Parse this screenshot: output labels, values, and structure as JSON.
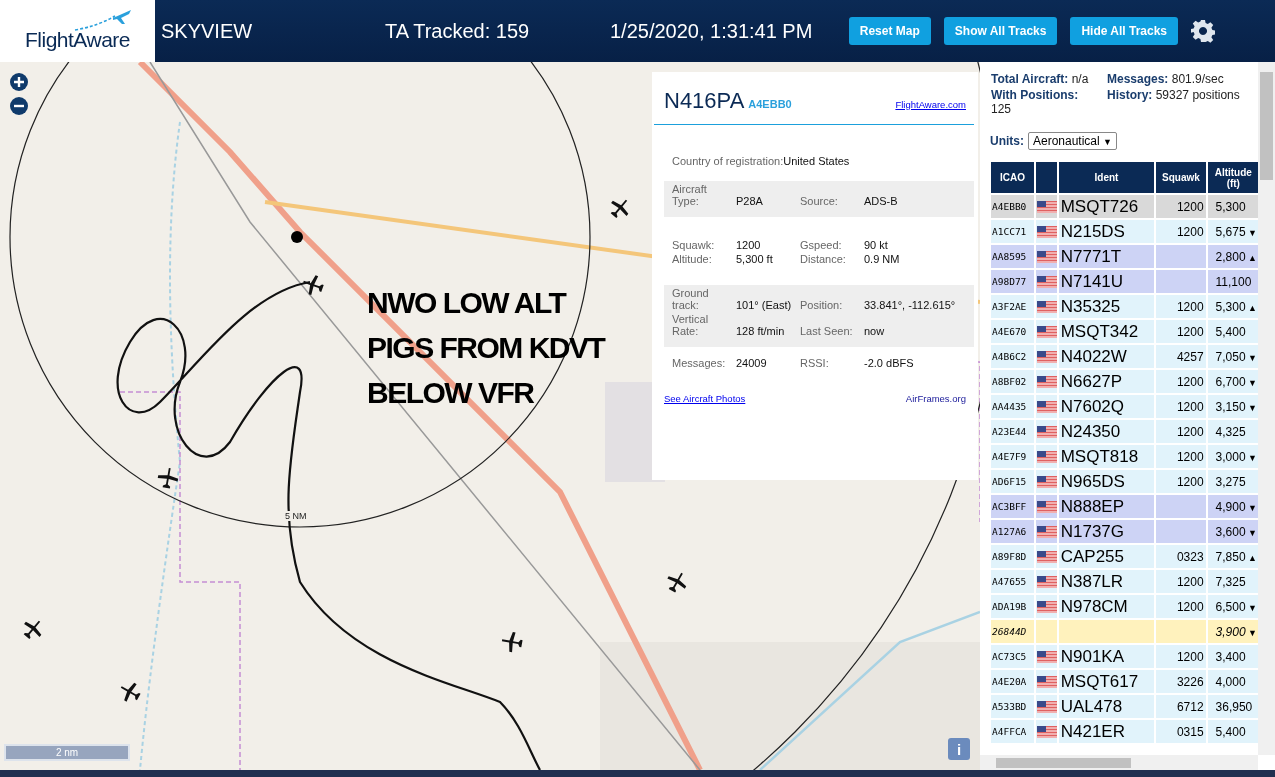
{
  "header": {
    "logo_text": "FlightAware",
    "app_title": "SKYVIEW",
    "tracked": "TA Tracked: 159",
    "datetime": "1/25/2020, 1:31:41 PM",
    "buttons": [
      "Reset Map",
      "Show All Tracks",
      "Hide All Tracks"
    ]
  },
  "map": {
    "annotation": [
      "NWO LOW ALT",
      "PIGS FROM KDVT",
      "BELOW VFR"
    ],
    "range_label": "5 NM",
    "scale": "2 nm",
    "info": "i"
  },
  "popup": {
    "ident": "N416PA",
    "icao": "A4EBB0",
    "link": "FlightAware.com",
    "country_label": "Country of registration:",
    "country": "United States",
    "groups": [
      {
        "shaded": true,
        "rows": [
          [
            "Aircraft Type:",
            "P28A",
            "Source:",
            "ADS-B"
          ]
        ]
      },
      {
        "shaded": false,
        "rows": [
          [
            "Squawk:",
            "1200",
            "Gspeed:",
            "90 kt"
          ],
          [
            "Altitude:",
            "5,300 ft",
            "Distance:",
            "0.9 NM"
          ]
        ]
      },
      {
        "shaded": true,
        "rows": [
          [
            "Ground track:",
            "101° (East)",
            "Position:",
            "33.841°, -112.615°"
          ],
          [
            "Vertical Rate:",
            "128 ft/min",
            "Last Seen:",
            "now"
          ]
        ]
      },
      {
        "shaded": false,
        "rows": [
          [
            "Messages:",
            "24009",
            "RSSI:",
            "-2.0 dBFS"
          ]
        ]
      }
    ],
    "photos_link": "See Aircraft Photos",
    "airframes_link": "AirFrames.org"
  },
  "stats": [
    {
      "label": "Total Aircraft:",
      "value": "n/a"
    },
    {
      "label": "Messages:",
      "value": "801.9/sec"
    },
    {
      "label": "With Positions:",
      "value": "125"
    },
    {
      "label": "History:",
      "value": "59327 positions"
    }
  ],
  "units": {
    "label": "Units:",
    "value": "Aeronautical",
    "caret": "▼"
  },
  "table": {
    "columns": [
      "ICAO",
      "",
      "Ident",
      "Squawk",
      "Altitude (ft)"
    ],
    "rows": [
      {
        "icao": "A4EBB0",
        "flag": true,
        "ident": "MSQT726",
        "squawk": "1200",
        "altitude": "5,300",
        "trend": "",
        "selected": true,
        "kind": "adsb"
      },
      {
        "icao": "A1CC71",
        "flag": true,
        "ident": "N215DS",
        "squawk": "1200",
        "altitude": "5,675",
        "trend": "▼",
        "selected": false,
        "kind": "adsb",
        "color": "#e1f3fb"
      },
      {
        "icao": "AA8595",
        "flag": true,
        "ident": "N7771T",
        "squawk": "",
        "altitude": "2,800",
        "trend": "▲",
        "selected": false,
        "kind": "adsb",
        "color": "#cdd3f5"
      },
      {
        "icao": "A98D77",
        "flag": true,
        "ident": "N7141U",
        "squawk": "",
        "altitude": "11,100",
        "trend": "",
        "selected": false,
        "kind": "adsb",
        "color": "#cdd3f5"
      },
      {
        "icao": "A3F2AE",
        "flag": true,
        "ident": "N35325",
        "squawk": "1200",
        "altitude": "5,300",
        "trend": "▲",
        "selected": false,
        "kind": "adsb",
        "color": "#e1f3fb"
      },
      {
        "icao": "A4E670",
        "flag": true,
        "ident": "MSQT342",
        "squawk": "1200",
        "altitude": "5,400",
        "trend": "",
        "selected": false,
        "kind": "adsb",
        "color": "#e1f3fb"
      },
      {
        "icao": "A4B6C2",
        "flag": true,
        "ident": "N4022W",
        "squawk": "4257",
        "altitude": "7,050",
        "trend": "▼",
        "selected": false,
        "kind": "adsb",
        "color": "#e1f3fb"
      },
      {
        "icao": "A8BF02",
        "flag": true,
        "ident": "N6627P",
        "squawk": "1200",
        "altitude": "6,700",
        "trend": "▼",
        "selected": false,
        "kind": "adsb",
        "color": "#e1f3fb"
      },
      {
        "icao": "AA4435",
        "flag": true,
        "ident": "N7602Q",
        "squawk": "1200",
        "altitude": "3,150",
        "trend": "▼",
        "selected": false,
        "kind": "adsb",
        "color": "#e1f3fb"
      },
      {
        "icao": "A23E44",
        "flag": true,
        "ident": "N24350",
        "squawk": "1200",
        "altitude": "4,325",
        "trend": "",
        "selected": false,
        "kind": "adsb",
        "color": "#e1f3fb"
      },
      {
        "icao": "A4E7F9",
        "flag": true,
        "ident": "MSQT818",
        "squawk": "1200",
        "altitude": "3,000",
        "trend": "▼",
        "selected": false,
        "kind": "adsb",
        "color": "#e1f3fb"
      },
      {
        "icao": "AD6F15",
        "flag": true,
        "ident": "N965DS",
        "squawk": "1200",
        "altitude": "3,275",
        "trend": "",
        "selected": false,
        "kind": "adsb",
        "color": "#e1f3fb"
      },
      {
        "icao": "AC3BFF",
        "flag": true,
        "ident": "N888EP",
        "squawk": "",
        "altitude": "4,900",
        "trend": "▼",
        "selected": false,
        "kind": "adsb",
        "color": "#cdd3f5"
      },
      {
        "icao": "A127A6",
        "flag": true,
        "ident": "N1737G",
        "squawk": "",
        "altitude": "3,600",
        "trend": "▼",
        "selected": false,
        "kind": "adsb",
        "color": "#cdd3f5"
      },
      {
        "icao": "A89F8D",
        "flag": true,
        "ident": "CAP255",
        "squawk": "0323",
        "altitude": "7,850",
        "trend": "▲",
        "selected": false,
        "kind": "adsb",
        "color": "#e1f3fb"
      },
      {
        "icao": "A47655",
        "flag": true,
        "ident": "N387LR",
        "squawk": "1200",
        "altitude": "7,325",
        "trend": "",
        "selected": false,
        "kind": "adsb",
        "color": "#e1f3fb"
      },
      {
        "icao": "ADA19B",
        "flag": true,
        "ident": "N978CM",
        "squawk": "1200",
        "altitude": "6,500",
        "trend": "▼",
        "selected": false,
        "kind": "adsb",
        "color": "#e1f3fb"
      },
      {
        "icao": "26844D",
        "flag": false,
        "ident": "",
        "squawk": "",
        "altitude": "3,900",
        "trend": "▼",
        "selected": false,
        "kind": "other",
        "color": "#fff2bd"
      },
      {
        "icao": "AC73C5",
        "flag": true,
        "ident": "N901KA",
        "squawk": "1200",
        "altitude": "3,400",
        "trend": "",
        "selected": false,
        "kind": "adsb",
        "color": "#e1f3fb"
      },
      {
        "icao": "A4E20A",
        "flag": true,
        "ident": "MSQT617",
        "squawk": "3226",
        "altitude": "4,000",
        "trend": "",
        "selected": false,
        "kind": "adsb",
        "color": "#e1f3fb"
      },
      {
        "icao": "A533BD",
        "flag": true,
        "ident": "UAL478",
        "squawk": "6712",
        "altitude": "36,950",
        "trend": "",
        "selected": false,
        "kind": "adsb",
        "color": "#e1f3fb"
      },
      {
        "icao": "A4FFCA",
        "flag": true,
        "ident": "N421ER",
        "squawk": "0315",
        "altitude": "5,400",
        "trend": "",
        "selected": false,
        "kind": "adsb",
        "color": "#e1f3fb"
      }
    ]
  }
}
